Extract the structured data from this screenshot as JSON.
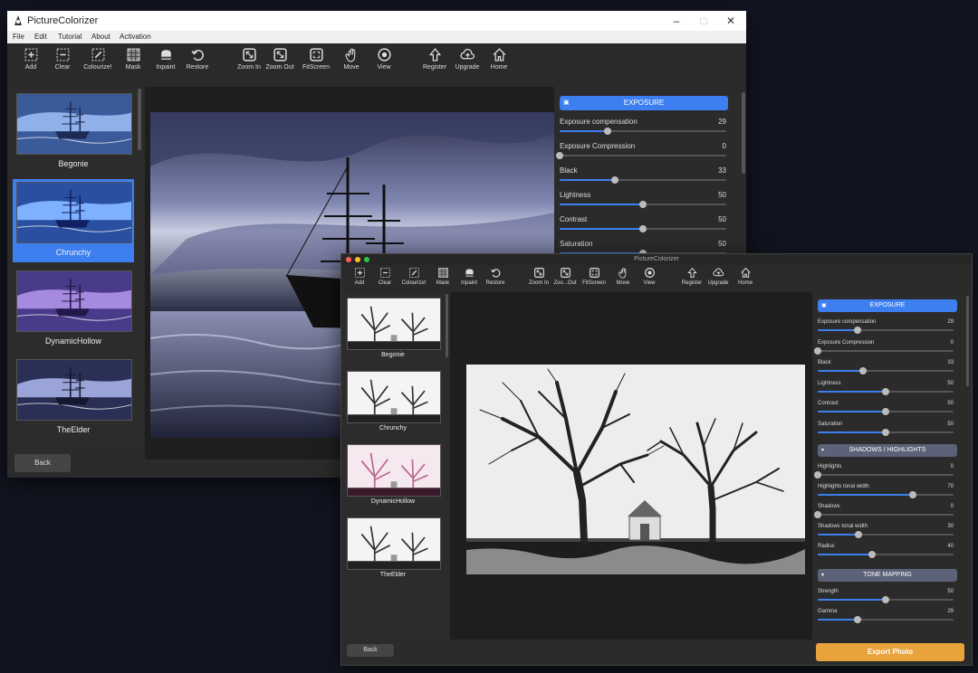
{
  "window_back": {
    "title": "PictureColorizer",
    "menu": [
      "File",
      "Edit",
      "Tutorial",
      "About",
      "Activation"
    ],
    "toolbar": [
      {
        "label": "Add",
        "icon": "add-icon"
      },
      {
        "label": "Clear",
        "icon": "clear-icon"
      },
      {
        "label": "Colourize!",
        "icon": "colourize-icon"
      },
      {
        "label": "Mask",
        "icon": "mask-icon"
      },
      {
        "label": "Inpaint",
        "icon": "inpaint-icon"
      },
      {
        "label": "Restore",
        "icon": "restore-icon"
      },
      {
        "label": "Zoom In",
        "icon": "zoom-in-icon"
      },
      {
        "label": "Zoom Out",
        "icon": "zoom-out-icon"
      },
      {
        "label": "FitScreen",
        "icon": "fit-screen-icon"
      },
      {
        "label": "Move",
        "icon": "move-icon"
      },
      {
        "label": "View",
        "icon": "view-icon"
      },
      {
        "label": "Register",
        "icon": "register-icon"
      },
      {
        "label": "Upgrade",
        "icon": "upgrade-icon"
      },
      {
        "label": "Home",
        "icon": "home-icon"
      }
    ],
    "presets": [
      "Begonie",
      "Chrunchy",
      "DynamicHollow",
      "TheElder"
    ],
    "selected_preset": "Chrunchy",
    "back_label": "Back",
    "exposure_title": "EXPOSURE",
    "params": [
      {
        "name": "Exposure compensation",
        "value": "29",
        "level": 0.29
      },
      {
        "name": "Exposure Compression",
        "value": "0",
        "level": 0.0
      },
      {
        "name": "Black",
        "value": "33",
        "level": 0.33
      },
      {
        "name": "Lightness",
        "value": "50",
        "level": 0.5
      },
      {
        "name": "Contrast",
        "value": "50",
        "level": 0.5
      },
      {
        "name": "Saturation",
        "value": "50",
        "level": 0.5
      }
    ]
  },
  "window_front": {
    "title": "PictureColorizer",
    "toolbar": [
      {
        "label": "Add",
        "icon": "add-icon"
      },
      {
        "label": "Clear",
        "icon": "clear-icon"
      },
      {
        "label": "Colourize!",
        "icon": "colourize-icon"
      },
      {
        "label": "Mask",
        "icon": "mask-icon"
      },
      {
        "label": "Inpaint",
        "icon": "inpaint-icon"
      },
      {
        "label": "Restore",
        "icon": "restore-icon"
      },
      {
        "label": "Zoom In",
        "icon": "zoom-in-icon"
      },
      {
        "label": "Zoo...Out",
        "icon": "zoom-out-icon"
      },
      {
        "label": "FitScreen",
        "icon": "fit-screen-icon"
      },
      {
        "label": "Move",
        "icon": "move-icon"
      },
      {
        "label": "View",
        "icon": "view-icon"
      },
      {
        "label": "Register",
        "icon": "register-icon"
      },
      {
        "label": "Upgrade",
        "icon": "upgrade-icon"
      },
      {
        "label": "Home",
        "icon": "home-icon"
      }
    ],
    "presets": [
      "Begonie",
      "Chrunchy",
      "DynamicHollow",
      "TheElder"
    ],
    "back_label": "Back",
    "export_label": "Export Photo",
    "exposure_title": "EXPOSURE",
    "exposure": [
      {
        "name": "Exposure compensation",
        "value": "29",
        "level": 0.29
      },
      {
        "name": "Exposure  Compression",
        "value": "0",
        "level": 0.0
      },
      {
        "name": "Black",
        "value": "33",
        "level": 0.33
      },
      {
        "name": "Lightness",
        "value": "50",
        "level": 0.5
      },
      {
        "name": "Contrast",
        "value": "50",
        "level": 0.5
      },
      {
        "name": "Saturation",
        "value": "50",
        "level": 0.5
      }
    ],
    "shadows_title": "SHADOWS / HIGHLIGHTS",
    "shadows": [
      {
        "name": "Highlights",
        "value": "0",
        "level": 0.0
      },
      {
        "name": "Highlights tonal width",
        "value": "70",
        "level": 0.7
      },
      {
        "name": "Shadows",
        "value": "0",
        "level": 0.0
      },
      {
        "name": "Shadows tonal width",
        "value": "30",
        "level": 0.3
      },
      {
        "name": "Radius",
        "value": "40",
        "level": 0.4
      }
    ],
    "tone_title": "TONE MAPPING",
    "tone": [
      {
        "name": "Strength",
        "value": "50",
        "level": 0.5
      },
      {
        "name": "Gamma",
        "value": "29",
        "level": 0.29
      }
    ]
  },
  "colors": {
    "accent": "#3d7ff0",
    "export": "#e8a33d",
    "section_gray": "#5c6278"
  }
}
